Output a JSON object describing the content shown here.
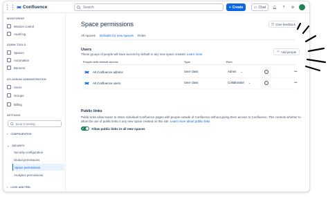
{
  "topbar": {
    "product": "Confluence",
    "search_placeholder": "Search",
    "create_label": "Create",
    "chat_label": "Chat"
  },
  "sidebar": {
    "sections": [
      {
        "title": "MONITORING",
        "items": [
          "Mission control",
          "Audit log"
        ]
      },
      {
        "title": "ADMIN TOOLS",
        "items": [
          "Spaces",
          "Automation",
          "Banners"
        ]
      },
      {
        "title": "ATLASSIAN ADMINISTRATION",
        "items": [
          "Users",
          "Groups",
          "Billing"
        ]
      }
    ],
    "settings_title": "SETTINGS",
    "search_placeholder": "Jump to setting...",
    "configuration_label": "CONFIGURATION",
    "security_label": "SECURITY",
    "security_items": [
      "Security configuration",
      "Global permissions",
      "Space permissions",
      "Analytics permissions"
    ],
    "active_item": "Space permissions",
    "look_and_feel_label": "LOOK AND FEEL"
  },
  "main": {
    "title": "Space permissions",
    "feedback_label": "Give feedback",
    "tabs": [
      "All spaces",
      "Defaults for new spaces",
      "Roles"
    ],
    "active_tab": "Defaults for new spaces",
    "users": {
      "heading": "Users",
      "description": "These groups of people will have access by default to any new space created.",
      "learn_more": "Learn more",
      "add_people_label": "Add people",
      "columns": [
        "People with default access",
        "Type",
        "Role"
      ],
      "rows": [
        {
          "name": "All Confluence admins",
          "type": "User class",
          "role": "Admin"
        },
        {
          "name": "All Confluence users",
          "type": "User class",
          "role": "Collaborator"
        }
      ]
    },
    "public_links": {
      "heading": "Public links",
      "description": "Public links allow teams to share individual Confluence pages with people outside of Confluence without giving them access to Confluence. This controls whether to allow the use of public links in any new space created on this site.",
      "learn_more": "Learn more about public links",
      "toggle_label": "Allow public links in all new spaces",
      "toggle_on": true
    }
  },
  "colors": {
    "brand_blue": "#0c66e4",
    "toggle_green": "#1f845a",
    "avatar_green": "#1f845a"
  }
}
